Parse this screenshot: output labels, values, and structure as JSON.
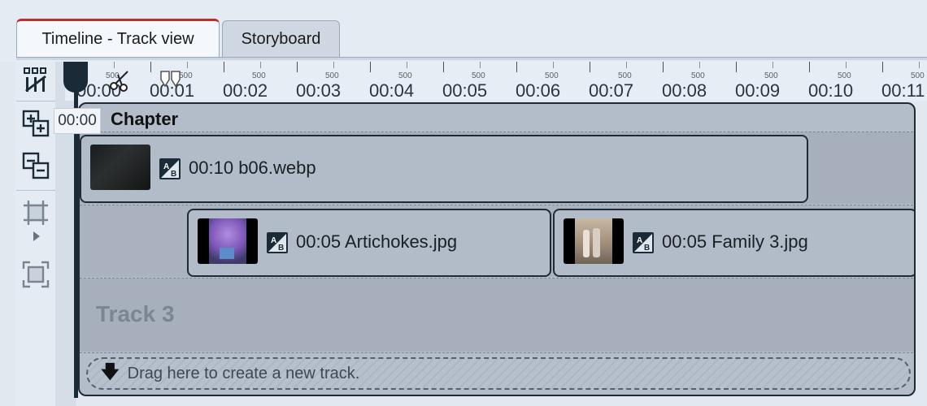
{
  "tabs": [
    {
      "label": "Timeline - Track view",
      "active": true
    },
    {
      "label": "Storyboard",
      "active": false
    }
  ],
  "toolbar": {
    "icons": [
      "split-tracks-icon",
      "add-chapter-icon",
      "remove-chapter-icon",
      "crop-frame-icon",
      "fit-frame-icon"
    ],
    "expand_icon": "chevron-right-icon"
  },
  "ruler": {
    "seconds": [
      "00:00",
      "00:01",
      "00:02",
      "00:03",
      "00:04",
      "00:05",
      "00:06",
      "00:07",
      "00:08",
      "00:09",
      "00:10",
      "00:11"
    ],
    "sub_label": "500"
  },
  "playhead": {
    "time": "00:00"
  },
  "chapter": {
    "title": "Chapter"
  },
  "tracks": {
    "track1": [
      {
        "duration": "00:10",
        "name": "b06.webp",
        "thumb": "dark-chalkboard"
      }
    ],
    "track2": [
      {
        "duration": "00:05",
        "name": "Artichokes.jpg",
        "thumb": "purple-flowers"
      },
      {
        "duration": "00:05",
        "name": "Family 3.jpg",
        "thumb": "family-photo"
      }
    ],
    "track3_label": "Track 3"
  },
  "dropzone": {
    "text": "Drag here to create a new track."
  },
  "colors": {
    "accent_tab": "#b7322b",
    "playhead": "#1b2a37",
    "clip_border": "#1f2a36"
  }
}
